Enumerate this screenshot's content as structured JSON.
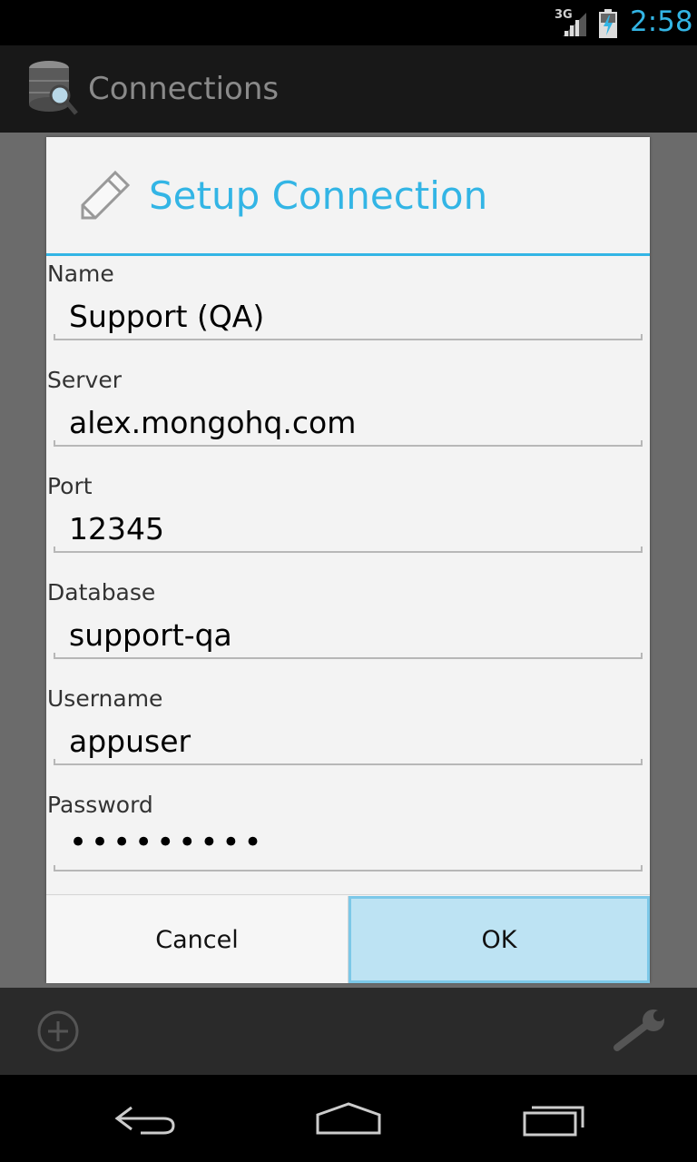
{
  "status_bar": {
    "network": "3G",
    "time": "2:58",
    "accent_color": "#33b5e5"
  },
  "action_bar": {
    "title": "Connections",
    "app_icon": "database-search-icon"
  },
  "dialog": {
    "title": "Setup Connection",
    "title_icon": "pencil-icon",
    "fields": [
      {
        "label": "Name",
        "value": "Support (QA)"
      },
      {
        "label": "Server",
        "value": "alex.mongohq.com"
      },
      {
        "label": "Port",
        "value": "12345"
      },
      {
        "label": "Database",
        "value": "support-qa"
      },
      {
        "label": "Username",
        "value": "appuser"
      },
      {
        "label": "Password",
        "value": "•••••••••"
      }
    ],
    "cancel_label": "Cancel",
    "ok_label": "OK"
  },
  "bottom_bar": {
    "left_icon": "add-icon",
    "right_icon": "wrench-icon"
  },
  "nav_bar": {
    "icons": [
      "back-icon",
      "home-icon",
      "recent-apps-icon"
    ]
  }
}
